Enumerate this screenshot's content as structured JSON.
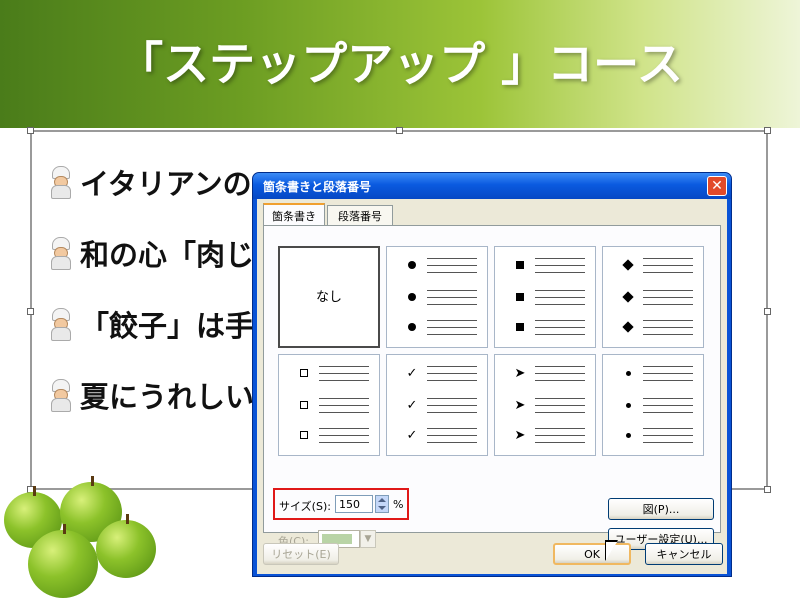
{
  "slide": {
    "title": "「ステップアップ 」コース",
    "bullets": [
      "イタリアンの",
      "和の心「肉じ",
      "「餃子」は手",
      "夏にうれしい"
    ],
    "bullet_icon": "chef-icon"
  },
  "dialog": {
    "title": "箇条書きと段落番号",
    "close_icon": "close-icon",
    "tabs": [
      {
        "label": "箇条書き",
        "selected": true
      },
      {
        "label": "段落番号",
        "selected": false
      }
    ],
    "bullet_styles": [
      {
        "label": "なし",
        "marker": "none",
        "selected": true
      },
      {
        "marker": "filled-circle"
      },
      {
        "marker": "filled-square"
      },
      {
        "marker": "filled-diamond"
      },
      {
        "marker": "hollow-square"
      },
      {
        "marker": "checkmark",
        "glyph": "✓"
      },
      {
        "marker": "arrowhead",
        "glyph": "➤"
      },
      {
        "marker": "small-dot"
      }
    ],
    "size": {
      "label": "サイズ(S):",
      "value": "150",
      "unit": "%"
    },
    "color": {
      "label": "色(C):",
      "swatch": "#8ab86a",
      "enabled": false
    },
    "buttons": {
      "picture": "図(P)...",
      "customize": "ユーザー設定(U)...",
      "reset": "リセット(E)",
      "ok": "OK",
      "cancel": "キャンセル"
    }
  },
  "colors": {
    "banner_dark": "#4a7c1a",
    "banner_light": "#eef5d8",
    "titlebar": "#0a5ae0",
    "highlight_box": "#e01818"
  }
}
